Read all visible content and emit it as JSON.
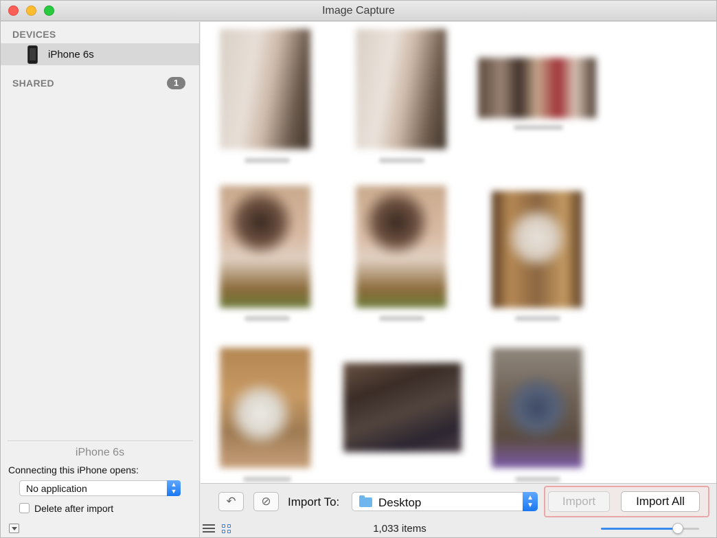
{
  "window": {
    "title": "Image Capture"
  },
  "sidebar": {
    "devices_header": "DEVICES",
    "device_name": "iPhone 6s",
    "shared_header": "SHARED",
    "shared_count": "1",
    "footer": {
      "device_name": "iPhone 6s",
      "opens_label": "Connecting this iPhone opens:",
      "app_value": "No application",
      "delete_label": "Delete after import",
      "delete_checked": false
    }
  },
  "toolbar": {
    "rotate_icon": "rotate-left-icon",
    "delete_icon": "no-entry-icon",
    "import_to_label": "Import To:",
    "destination": "Desktop",
    "import_label": "Import",
    "import_all_label": "Import All",
    "highlight_color": "#e9a7a7"
  },
  "status": {
    "item_count": "1,033 items",
    "thumbnail_size_fraction": 0.78
  },
  "colors": {
    "accent": "#1b78f2",
    "sidebar_bg": "#f0f0f0",
    "selection": "#d8d8d8"
  }
}
